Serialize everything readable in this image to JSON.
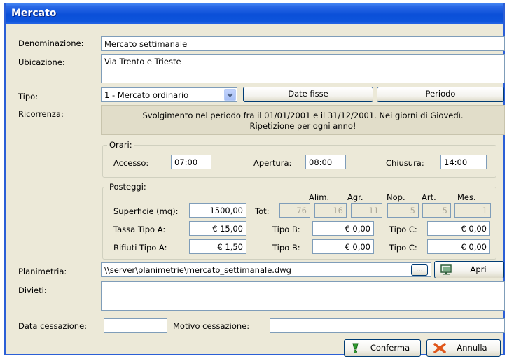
{
  "window": {
    "title": "Mercato"
  },
  "labels": {
    "denominazione": "Denominazione:",
    "ubicazione": "Ubicazione:",
    "tipo": "Tipo:",
    "ricorrenza": "Ricorrenza:",
    "planimetria": "Planimetria:",
    "divieti": "Divieti:",
    "data_cessazione": "Data cessazione:",
    "motivo_cessazione": "Motivo cessazione:"
  },
  "fields": {
    "denominazione": "Mercato settimanale",
    "ubicazione": "Via Trento e Trieste",
    "tipo": "1 - Mercato ordinario",
    "planimetria": "\\\\server\\planimetrie\\mercato_settimanale.dwg",
    "divieti": "",
    "data_cessazione": "",
    "motivo_cessazione": ""
  },
  "buttons": {
    "date_fisse": "Date fisse",
    "periodo": "Periodo",
    "browse": "...",
    "apri": "Apri",
    "conferma": "Conferma",
    "annulla": "Annulla"
  },
  "ricorrenza": {
    "line1": "Svolgimento nel periodo fra il 01/01/2001 e il 31/12/2001. Nei giorni di Giovedì.",
    "line2": "Ripetizione per ogni anno!"
  },
  "orari": {
    "title": "Orari:",
    "accesso_label": "Accesso:",
    "accesso": "07:00",
    "apertura_label": "Apertura:",
    "apertura": "08:00",
    "chiusura_label": "Chiusura:",
    "chiusura": "14:00"
  },
  "posteggi": {
    "title": "Posteggi:",
    "headers": {
      "alim": "Alim.",
      "agr": "Agr.",
      "nop": "Nop.",
      "art": "Art.",
      "mes": "Mes."
    },
    "superficie_label": "Superficie (mq):",
    "superficie": "1500,00",
    "tot_label": "Tot:",
    "tot": "76",
    "alim": "16",
    "agr": "11",
    "nop": "5",
    "art": "5",
    "mes": "1",
    "tassa_a_label": "Tassa Tipo A:",
    "tassa_a": "€ 15,00",
    "tassa_b_label": "Tipo B:",
    "tassa_b": "€  0,00",
    "tassa_c_label": "Tipo C:",
    "tassa_c": "€  0,00",
    "rifiuti_a_label": "Rifiuti Tipo A:",
    "rifiuti_a": "€  1,50",
    "rifiuti_b_label": "Tipo B:",
    "rifiuti_b": "€  0,00",
    "rifiuti_c_label": "Tipo C:",
    "rifiuti_c": "€  0,00"
  },
  "icons": {
    "combo": "chevron-down-icon",
    "apri": "monitor-icon",
    "conferma": "check-icon",
    "annulla": "x-icon"
  },
  "colors": {
    "titlebar": "#0a4fd8",
    "window_bg": "#ece9d8",
    "field_border": "#7f9db9"
  }
}
